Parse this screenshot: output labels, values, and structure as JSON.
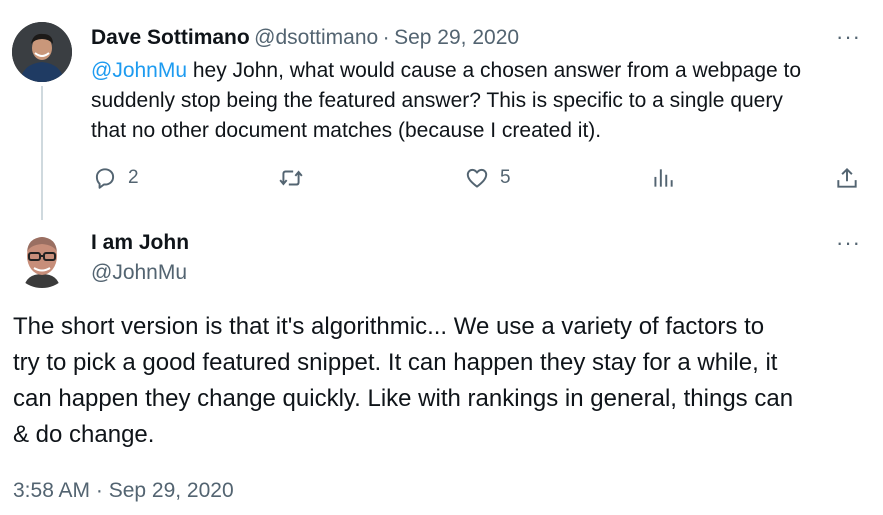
{
  "reply_tweet": {
    "author_name": "Dave Sottimano",
    "author_handle": "@dsottimano",
    "separator": "·",
    "date": "Sep 29, 2020",
    "more_label": "···",
    "mention": "@JohnMu",
    "text_lines": [
      " hey John, what would cause a chosen answer from a webpage to",
      "suddenly stop being the featured answer?  This is specific to a single query",
      "that no other document matches (because I created it)."
    ],
    "actions": {
      "reply_count": "2",
      "retweet_count": "",
      "like_count": "5",
      "views_count": ""
    }
  },
  "main_tweet": {
    "author_name": "I am John",
    "author_handle": "@JohnMu",
    "more_label": "···",
    "text_lines": [
      "The  short version is that it's algorithmic... We use a variety of factors to",
      "try to pick a good featured snippet. It can happen they stay for a while, it",
      "can happen they change quickly. Like with rankings in general, things can",
      "& do change."
    ],
    "timestamp": "3:58 AM · Sep 29, 2020"
  },
  "colors": {
    "text": "#0f1419",
    "muted": "#536471",
    "link": "#1d9bf0",
    "thread_line": "#cfd9de"
  },
  "icons": [
    "reply-icon",
    "retweet-icon",
    "like-icon",
    "views-icon",
    "share-icon",
    "more-icon"
  ]
}
